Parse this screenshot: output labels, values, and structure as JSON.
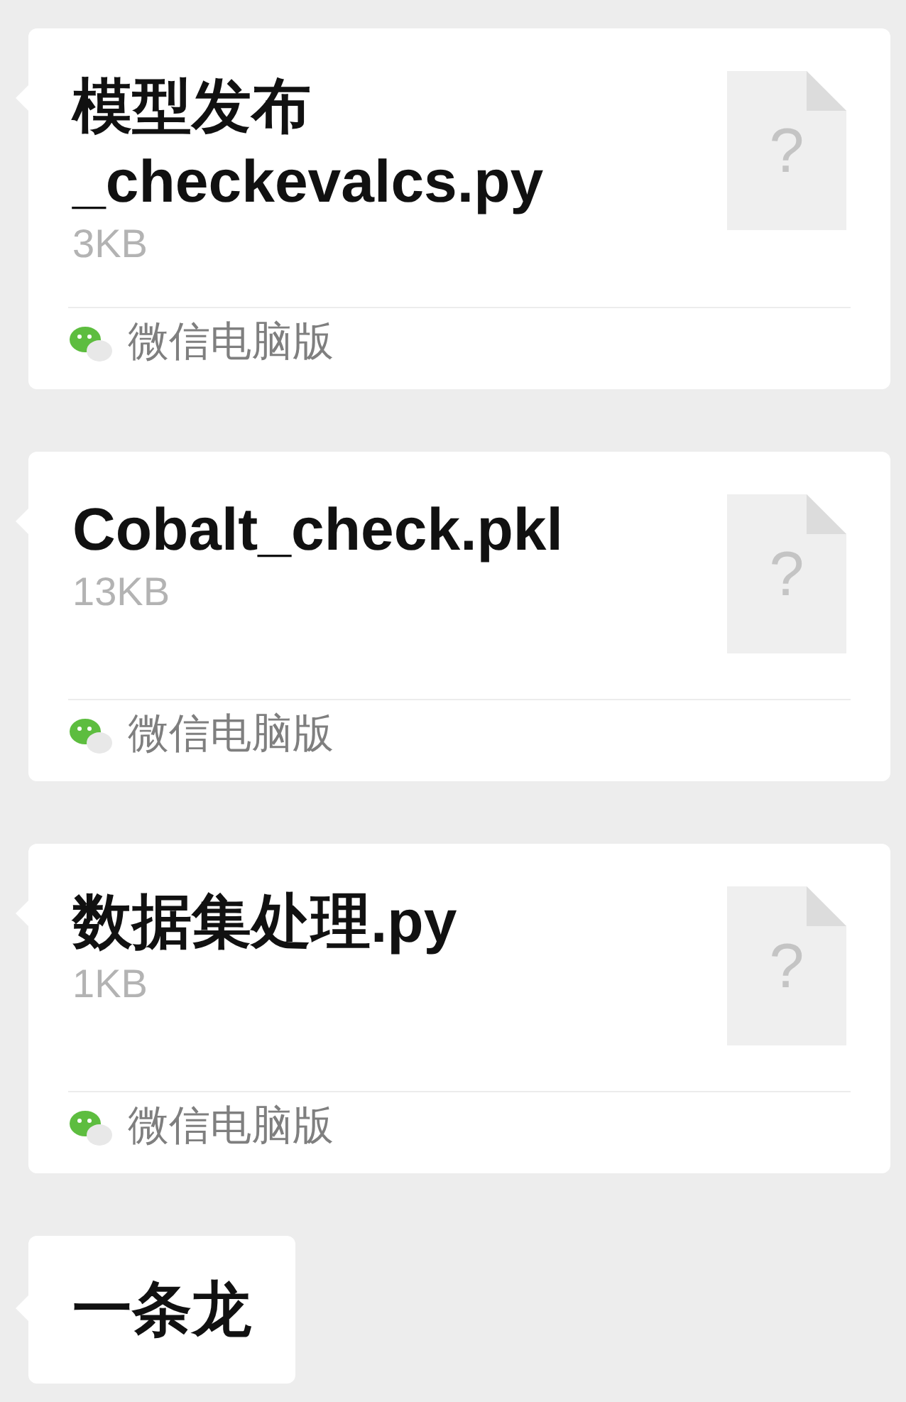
{
  "messages": [
    {
      "kind": "file",
      "name": "模型发布_checkevalcs.py",
      "size": "3KB",
      "icon_text": "?",
      "source": "微信电脑版"
    },
    {
      "kind": "file",
      "name": "Cobalt_check.pkl",
      "size": "13KB",
      "icon_text": "?",
      "source": "微信电脑版"
    },
    {
      "kind": "file",
      "name": "数据集处理.py",
      "size": "1KB",
      "icon_text": "?",
      "source": "微信电脑版"
    },
    {
      "kind": "text",
      "text": "一条龙"
    }
  ]
}
